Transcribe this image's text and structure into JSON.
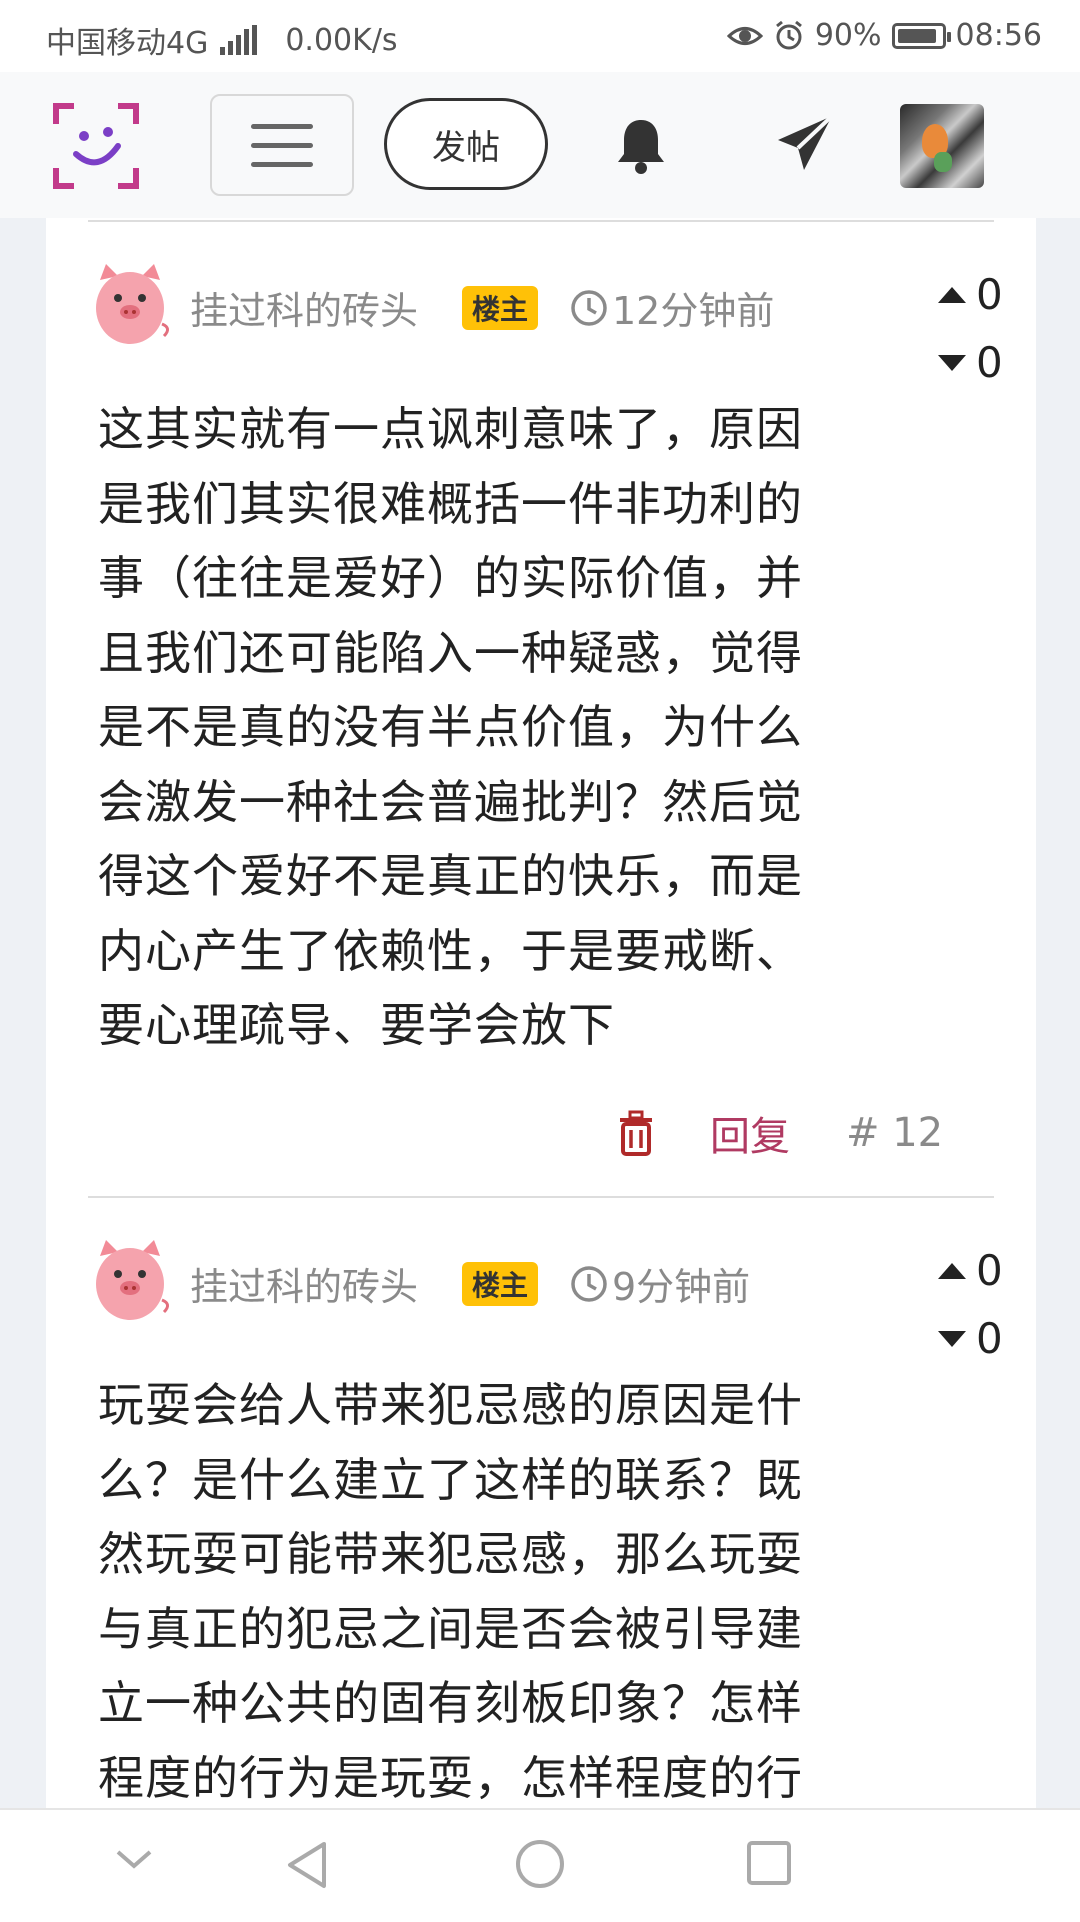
{
  "status_bar": {
    "carrier": "中国移动4G",
    "net_type": "4G",
    "net_speed": "0.00K/s",
    "battery": "90%",
    "battery_level": 0.9,
    "time": "08:56"
  },
  "nav": {
    "post_label": "发帖"
  },
  "posts": [
    {
      "author": "挂过科的砖头",
      "badge": "楼主",
      "time": "12分钟前",
      "upvotes": "0",
      "downvotes": "0",
      "lines": [
        "这其实就有一点讽刺意味了，原因",
        "是我们其实很难概括一件非功利的",
        "事（往往是爱好）的实际价值，并",
        "且我们还可能陷入一种疑惑，觉得",
        "是不是真的没有半点价值，为什么",
        "会激发一种社会普遍批判？然后觉",
        "得这个爱好不是真正的快乐，而是",
        "内心产生了依赖性，于是要戒断、",
        "要心理疏导、要学会放下"
      ],
      "reply_label": "回复",
      "floor": "# 12"
    },
    {
      "author": "挂过科的砖头",
      "badge": "楼主",
      "time": "9分钟前",
      "upvotes": "0",
      "downvotes": "0",
      "lines": [
        "玩耍会给人带来犯忌感的原因是什",
        "么？是什么建立了这样的联系？既",
        "然玩耍可能带来犯忌感，那么玩耍",
        "与真正的犯忌之间是否会被引导建",
        "立一种公共的固有刻板印象？怎样",
        "程度的行为是玩耍，怎样程度的行"
      ]
    }
  ],
  "colors": {
    "accent_reply": "#b03a62",
    "badge": "#ffc107",
    "logo": "#9b3fb8"
  },
  "icons": [
    "eye-icon",
    "alarm-icon",
    "bell-icon",
    "send-icon",
    "clock-icon",
    "trash-icon",
    "pig-avatar-icon",
    "chevron-down-icon",
    "back-icon",
    "home-icon",
    "recents-icon"
  ]
}
